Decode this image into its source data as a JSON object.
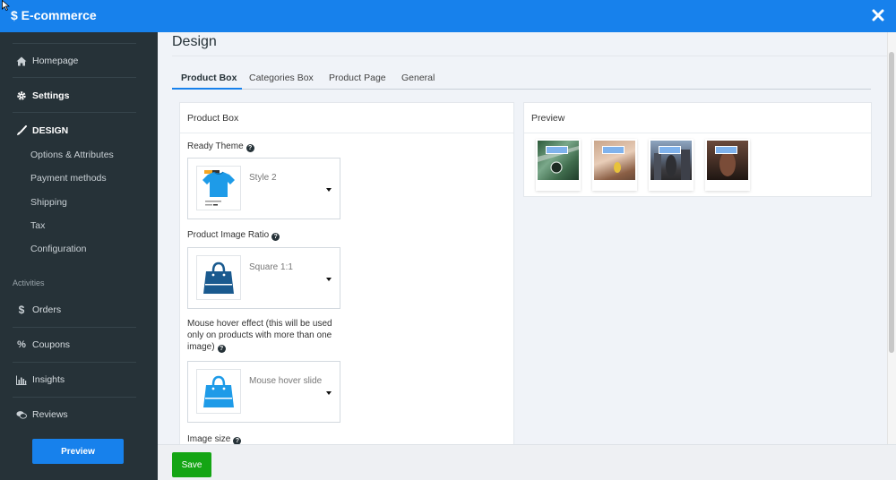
{
  "app": {
    "title": "$ E-commerce"
  },
  "sidebar": {
    "items": [
      {
        "label": "Homepage",
        "icon": "home-icon"
      },
      {
        "label": "Settings",
        "icon": "gear-icon"
      },
      {
        "label": "DESIGN",
        "icon": "brush-icon"
      }
    ],
    "design_subitems": [
      "Options & Attributes",
      "Payment methods",
      "Shipping",
      "Tax",
      "Configuration"
    ],
    "section_label": "Activities",
    "activity_items": [
      {
        "label": "Orders",
        "icon": "dollar-icon"
      },
      {
        "label": "Coupons",
        "icon": "percent-icon"
      },
      {
        "label": "Insights",
        "icon": "bar-chart-icon"
      },
      {
        "label": "Reviews",
        "icon": "chat-icon"
      }
    ],
    "preview_label": "Preview"
  },
  "main": {
    "title": "Design",
    "tabs": [
      "Product Box",
      "Categories Box",
      "Product Page",
      "General"
    ],
    "active_tab": "Product Box"
  },
  "product_box": {
    "heading": "Product Box",
    "ready_theme": {
      "label": "Ready Theme",
      "value": "Style 2"
    },
    "image_ratio": {
      "label": "Product Image Ratio",
      "value": "Square 1:1"
    },
    "hover_effect": {
      "label_line1": "Mouse hover effect (this will be used",
      "label_line2": "only on products with more than one",
      "label_line3": "image)",
      "value": "Mouse hover slide"
    },
    "image_size": {
      "label": "Image size"
    }
  },
  "preview": {
    "heading": "Preview"
  },
  "footer": {
    "save_label": "Save"
  },
  "colors": {
    "accent": "#1781ec",
    "sidebar_bg": "#263238",
    "save": "#14a514"
  }
}
